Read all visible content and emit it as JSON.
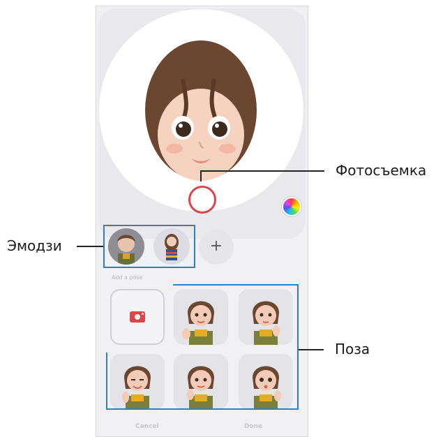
{
  "callouts": {
    "photo": "Фотосъемка",
    "emoji": "Эмодзи",
    "pose": "Поза"
  },
  "emoji_panel": {
    "add_label": "+",
    "section_title": "Add a pose"
  },
  "footer": {
    "cancel": "Cancel",
    "done": "Done"
  },
  "colors": {
    "accent_callout": "#2f7fc1",
    "shutter": "#e0444b",
    "background": "#f1f1f3"
  }
}
